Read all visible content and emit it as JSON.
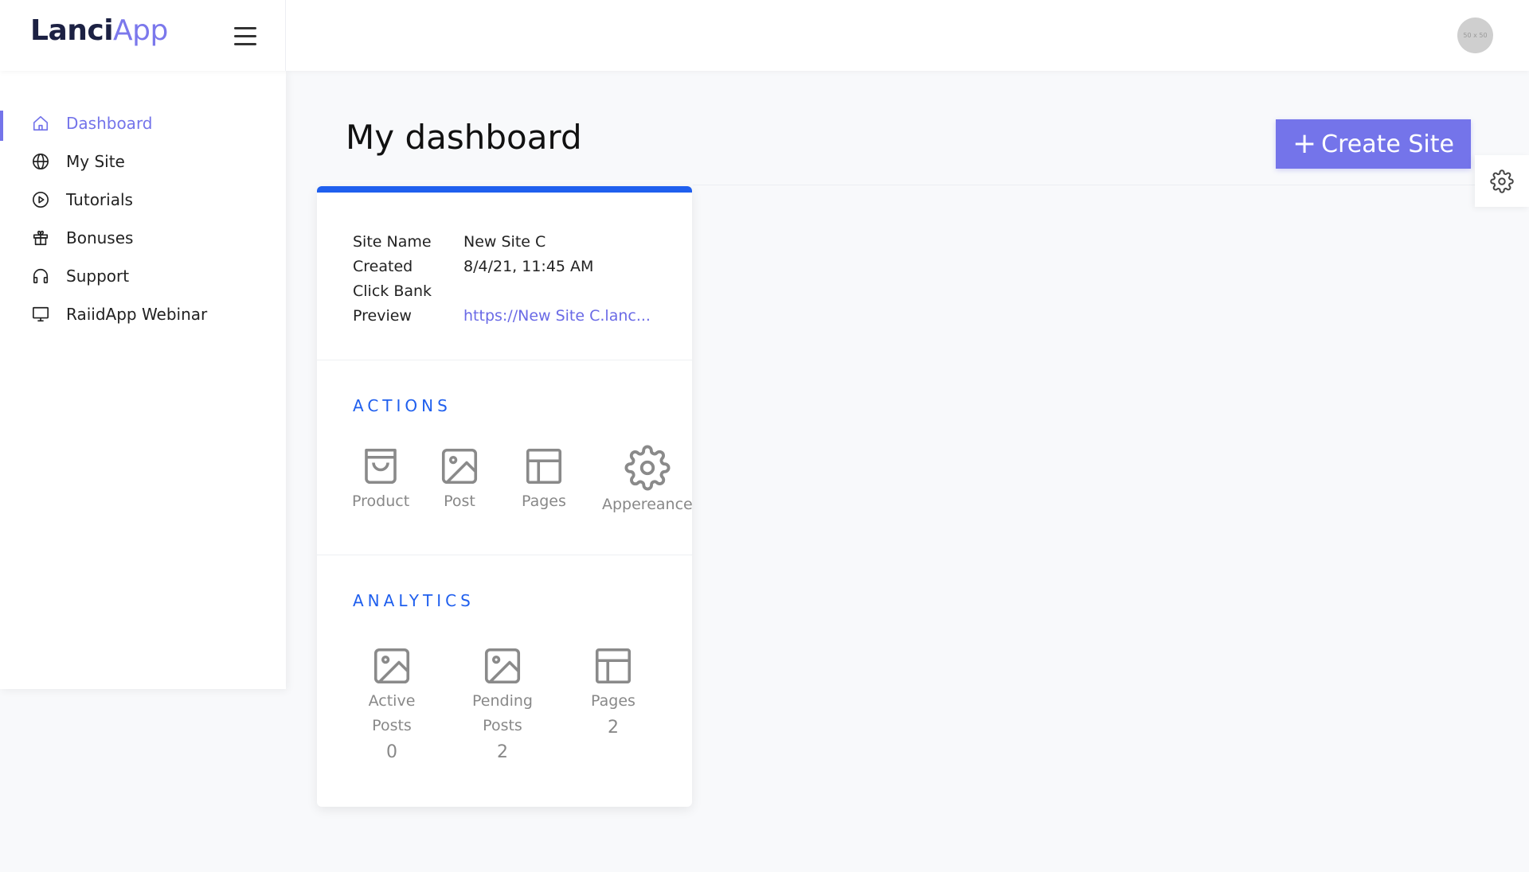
{
  "brand": {
    "part1": "Lanci",
    "part2": "App"
  },
  "header": {
    "avatar_text": "50 x 50"
  },
  "sidebar": {
    "items": [
      {
        "label": "Dashboard",
        "icon": "home-icon",
        "active": true
      },
      {
        "label": "My Site",
        "icon": "globe-icon"
      },
      {
        "label": "Tutorials",
        "icon": "play-circle-icon"
      },
      {
        "label": "Bonuses",
        "icon": "gift-icon"
      },
      {
        "label": "Support",
        "icon": "headphones-icon"
      },
      {
        "label": "RaiidApp Webinar",
        "icon": "monitor-icon"
      }
    ]
  },
  "main": {
    "title": "My dashboard",
    "create_button": {
      "label": "Create Site",
      "icon": "plus-icon"
    }
  },
  "card": {
    "info": [
      {
        "label": "Site Name",
        "value": "New Site C"
      },
      {
        "label": "Created",
        "value": "8/4/21, 11:45 AM"
      },
      {
        "label": "Click Bank",
        "value": ""
      },
      {
        "label": "Preview",
        "value": "https://New Site C.lanc..."
      }
    ],
    "actions_title": "ACTIONS",
    "actions": [
      {
        "label": "Product",
        "icon": "shopping-bag-icon"
      },
      {
        "label": "Post",
        "icon": "image-icon"
      },
      {
        "label": "Pages",
        "icon": "layout-icon"
      },
      {
        "label": "Appereance",
        "icon": "gear-icon"
      }
    ],
    "analytics_title": "ANALYTICS",
    "analytics": [
      {
        "label_line1": "Active",
        "label_line2": "Posts",
        "count": "0",
        "icon": "image-icon"
      },
      {
        "label_line1": "Pending",
        "label_line2": "Posts",
        "count": "2",
        "icon": "image-icon"
      },
      {
        "label_line1": "Pages",
        "label_line2": "",
        "count": "2",
        "icon": "layout-icon"
      }
    ]
  },
  "colors": {
    "accent": "#7474ea",
    "primary_blue": "#1f5fee",
    "brand_dark": "#1c2143"
  }
}
